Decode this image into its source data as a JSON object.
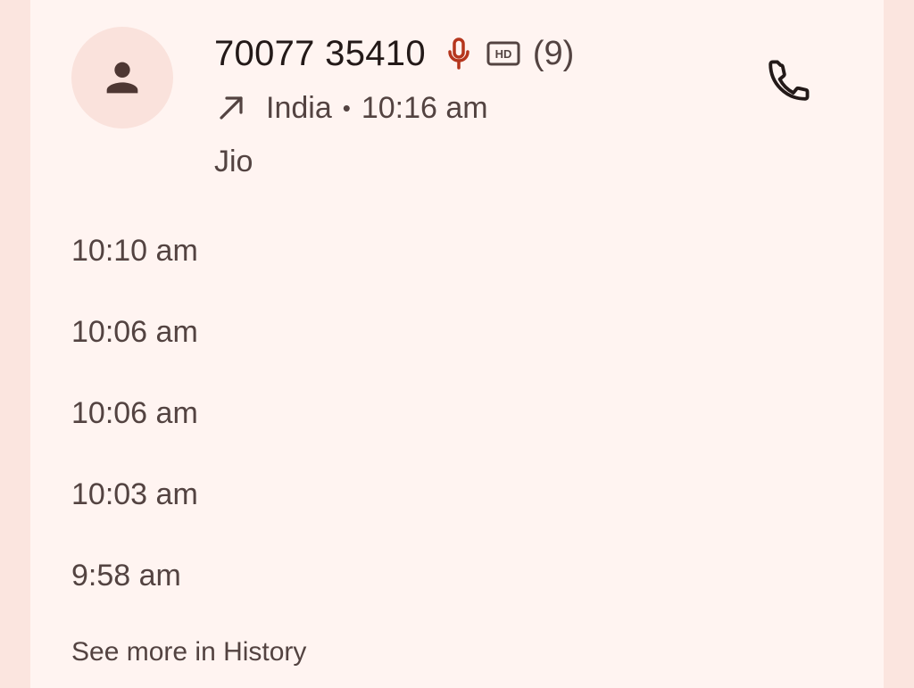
{
  "contact": {
    "number": "70077 35410",
    "count": "(9)",
    "direction_icon": "outgoing-arrow-icon",
    "location": "India",
    "separator": "•",
    "time": "10:16 am",
    "carrier": "Jio"
  },
  "icons": {
    "avatar": "person-icon",
    "mic": "mic-icon",
    "hd": "hd-icon",
    "call": "phone-icon"
  },
  "colors": {
    "accent_red": "#b5361d",
    "page_bg": "#fbe5df",
    "card_bg": "#fff4f1",
    "avatar_bg": "#fae2dc",
    "text_primary": "#231918",
    "text_secondary": "#534341"
  },
  "history": [
    "10:10 am",
    "10:06 am",
    "10:06 am",
    "10:03 am",
    "9:58 am"
  ],
  "see_more": "See more in History"
}
